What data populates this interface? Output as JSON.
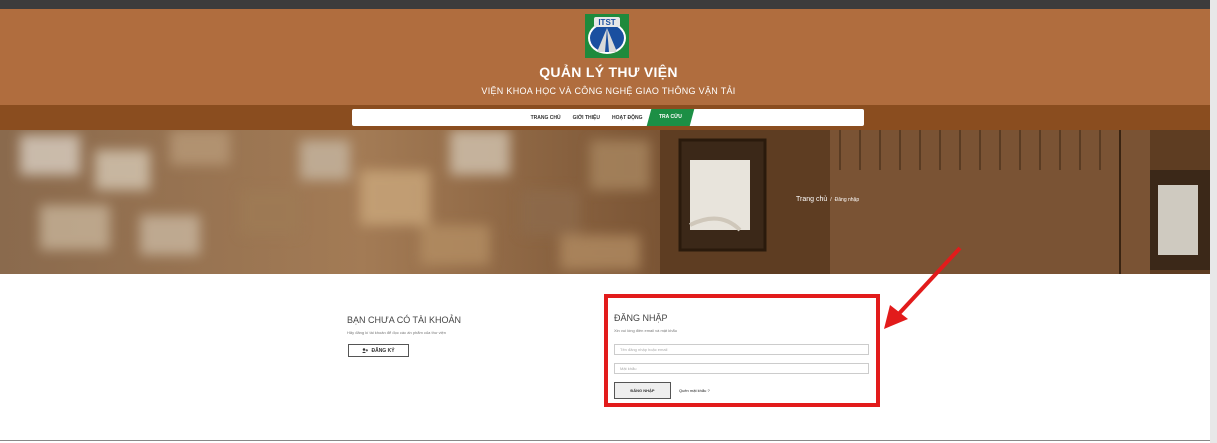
{
  "header": {
    "logo_text": "ITST",
    "title": "QUẢN LÝ THƯ VIỆN",
    "subtitle": "VIỆN KHOA HỌC VÀ CÔNG NGHỆ GIAO THÔNG VẬN TẢI"
  },
  "nav": {
    "items": [
      {
        "label": "TRANG CHỦ"
      },
      {
        "label": "GIỚI THIỆU"
      },
      {
        "label": "HOẠT ĐỘNG"
      },
      {
        "label": "TRA CỨU"
      }
    ],
    "active_color": "#1c8f45"
  },
  "breadcrumb": {
    "home": "Trang chủ",
    "separator": "/",
    "current": "Đăng nhập"
  },
  "register": {
    "heading": "BẠN CHƯA CÓ TÀI KHOẢN",
    "text": "Hãy đăng kí tài khoản để đọc các ấn phẩm của thư viện",
    "button_icon": "add-user-icon",
    "button_label": "ĐĂNG KÝ"
  },
  "login": {
    "heading": "ĐĂNG NHẬP",
    "text": "Xin vui lòng điền email và mật khẩu",
    "username_placeholder": "Tên đăng nhập hoặc email",
    "password_placeholder": "Mật khẩu",
    "button_label": "ĐĂNG NHẬP",
    "forgot_label": "Quên mật khẩu ?"
  },
  "colors": {
    "header_bg": "#b06d3e",
    "nav_band": "#8a4d1f",
    "highlight": "#e21b1b"
  }
}
